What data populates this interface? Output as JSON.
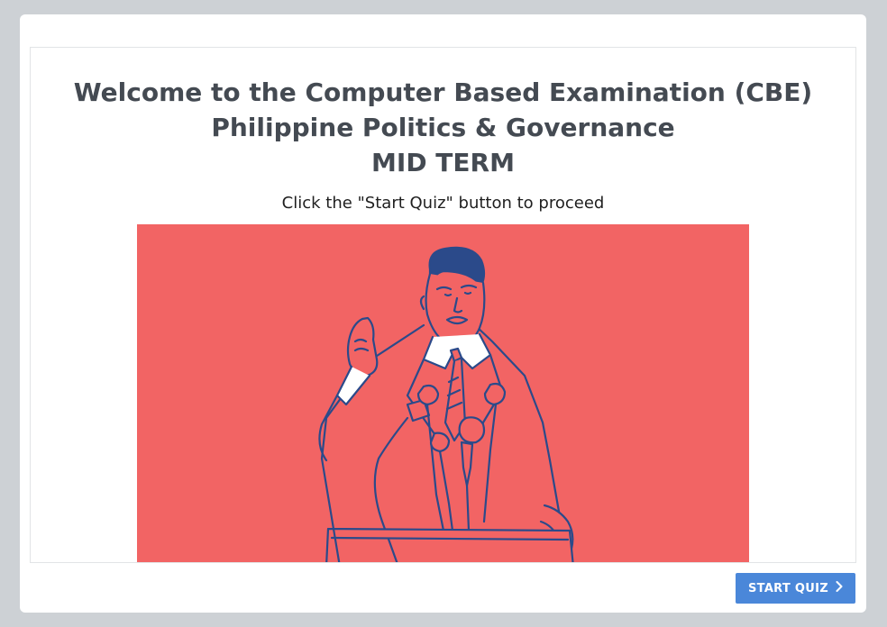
{
  "welcome": {
    "title_line1": "Welcome to the Computer Based Examination (CBE)",
    "title_line2": "Philippine Politics & Governance",
    "title_line3": "MID TERM",
    "instruction": "Click the \"Start Quiz\" button to proceed"
  },
  "illustration": {
    "subject": "politician speaking at podium with microphones",
    "background_color": "#f26464",
    "line_color": "#2b4a8a"
  },
  "footer": {
    "start_label": "START QUIZ",
    "start_icon": "chevron-right-icon",
    "button_color": "#4a87d9"
  }
}
